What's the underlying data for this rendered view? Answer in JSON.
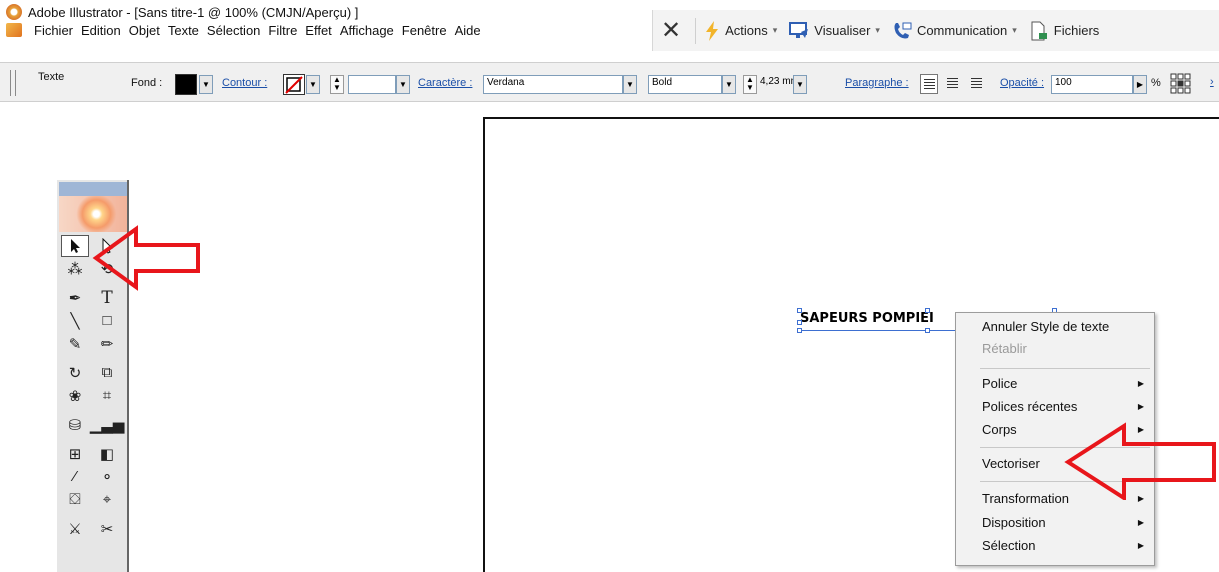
{
  "window": {
    "title": "Adobe Illustrator - [Sans titre-1 @ 100% (CMJN/Aperçu) ]"
  },
  "menu": {
    "items": [
      "Fichier",
      "Edition",
      "Objet",
      "Texte",
      "Sélection",
      "Filtre",
      "Effet",
      "Affichage",
      "Fenêtre",
      "Aide"
    ]
  },
  "topbar": {
    "actions": "Actions",
    "visualiser": "Visualiser",
    "communication": "Communication",
    "fichiers": "Fichiers",
    "caret": "▾"
  },
  "controlbar": {
    "mode_label": "Texte",
    "fond_label": "Fond :",
    "contour_label": "Contour :",
    "caractere_label": "Caractère :",
    "font_name": "Verdana",
    "font_style": "Bold",
    "font_size": "4,23 mn",
    "paragraphe_label": "Paragraphe :",
    "opacite_label": "Opacité :",
    "opacity_value": "100",
    "percent": "%"
  },
  "canvas": {
    "text_object": "SAPEURS POMPIEI"
  },
  "context_menu": {
    "items": [
      {
        "label": "Annuler Style de texte",
        "disabled": false,
        "submenu": false
      },
      {
        "label": "Rétablir",
        "disabled": true,
        "submenu": false
      },
      {
        "label": "Police",
        "disabled": false,
        "submenu": true
      },
      {
        "label": "Polices récentes",
        "disabled": false,
        "submenu": true
      },
      {
        "label": "Corps",
        "disabled": false,
        "submenu": true
      },
      {
        "label": "Vectoriser",
        "disabled": false,
        "submenu": false
      },
      {
        "label": "Transformation",
        "disabled": false,
        "submenu": true
      },
      {
        "label": "Disposition",
        "disabled": false,
        "submenu": true
      },
      {
        "label": "Sélection",
        "disabled": false,
        "submenu": true
      }
    ],
    "submenu_arrow": "▶"
  },
  "colors": {
    "annotation": "#e8161b",
    "selection": "#3d6fd1",
    "link": "#1b4fa8"
  },
  "icons": {
    "tools": [
      "selection-arrow-icon",
      "direct-selection-icon",
      "magic-wand-icon",
      "lasso-icon",
      "pen-icon",
      "type-icon",
      "line-icon",
      "rectangle-icon",
      "paintbrush-icon",
      "pencil-icon",
      "rotate-icon",
      "scale-icon",
      "warp-icon",
      "free-transform-icon",
      "symbol-sprayer-icon",
      "graph-icon",
      "mesh-icon",
      "gradient-icon",
      "eyedropper-icon",
      "blend-icon",
      "live-paint-icon",
      "live-paint-select-icon",
      "slice-icon",
      "scissors-icon"
    ]
  }
}
